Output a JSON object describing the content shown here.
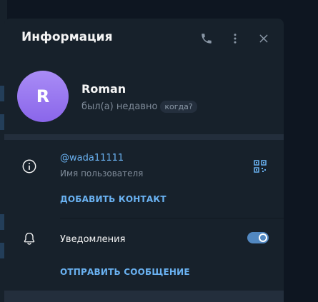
{
  "dialog": {
    "title": "Информация"
  },
  "profile": {
    "avatar_letter": "R",
    "name": "Roman",
    "status": "был(а) недавно",
    "when_badge": "когда?",
    "avatar_color": "#8f6cf0"
  },
  "info": {
    "username": "@wada11111",
    "username_label": "Имя пользователя",
    "add_contact": "ДОБАВИТЬ КОНТАКТ"
  },
  "notifications": {
    "label": "Уведомления",
    "enabled": true,
    "send_message": "ОТПРАВИТЬ СООБЩЕНИЕ"
  },
  "icons": {
    "call": "phone-icon",
    "more": "more-vertical-icon",
    "close": "close-icon",
    "info": "info-icon",
    "qr": "qr-code-icon",
    "bell": "bell-icon"
  },
  "colors": {
    "accent": "#6ab2f2",
    "background": "#17212b",
    "toggle_on": "#5288c1"
  }
}
